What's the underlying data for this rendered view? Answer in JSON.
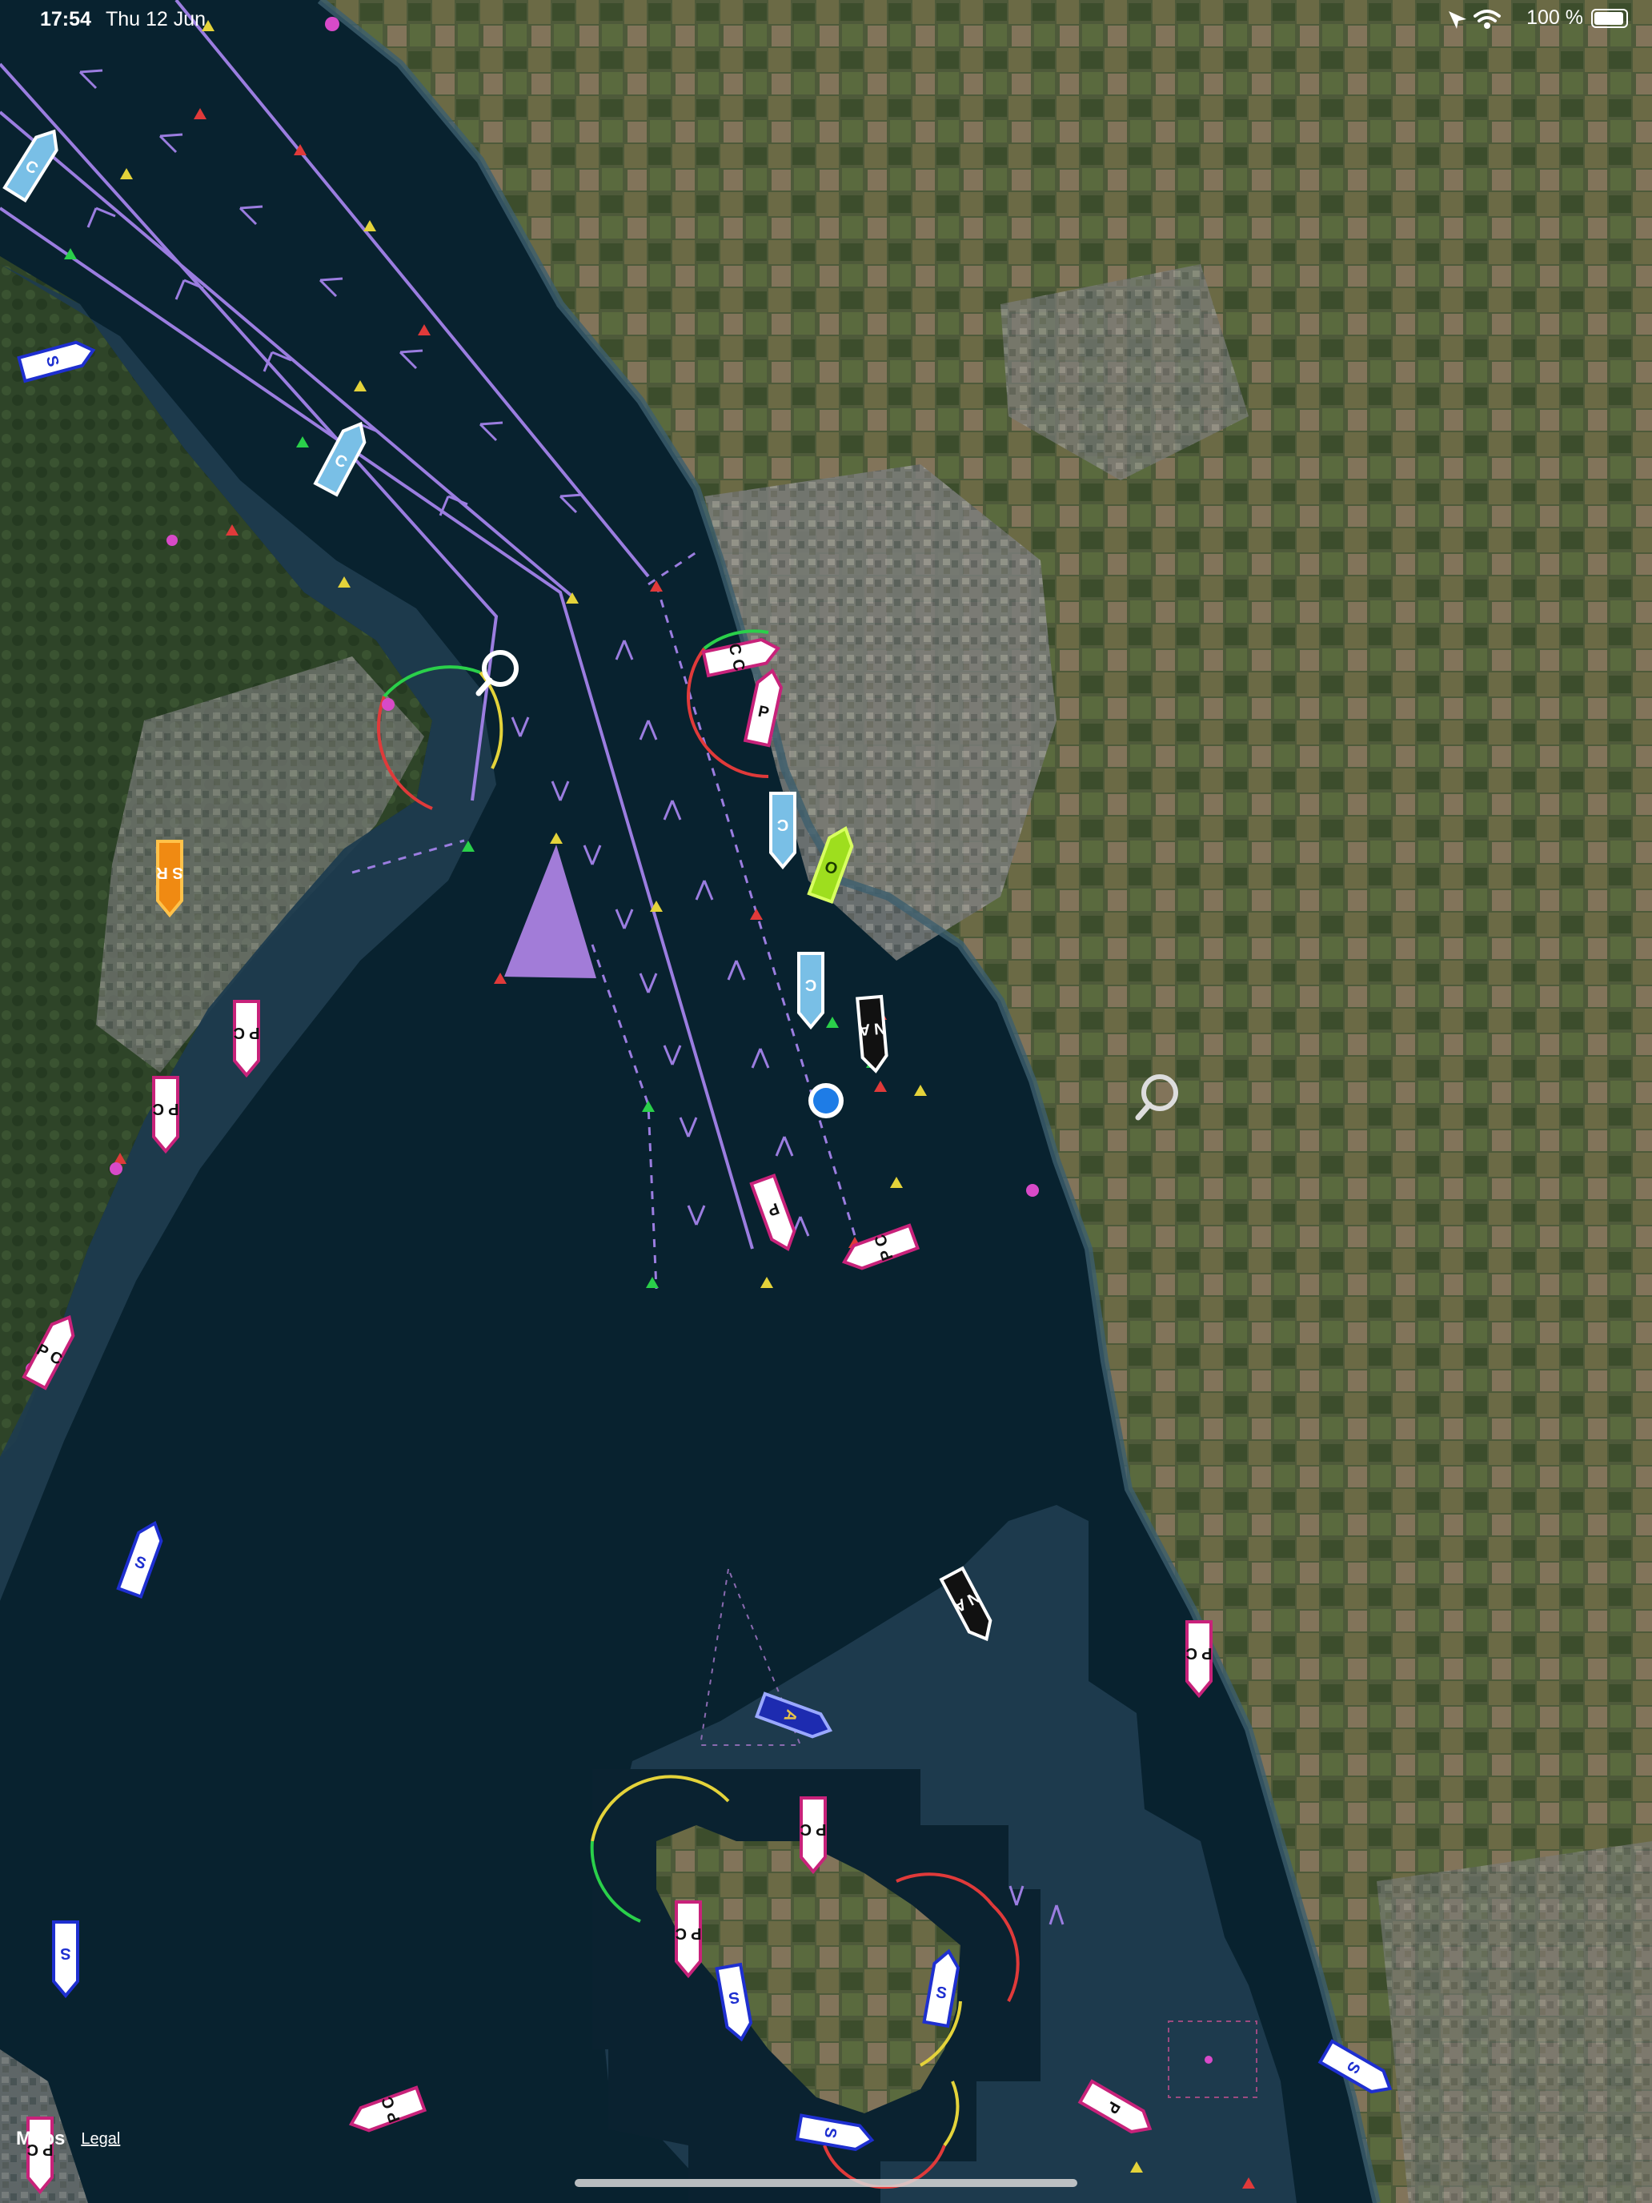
{
  "status_bar": {
    "time": "17:54",
    "date": "Thu 12 Jun",
    "battery": "100 %"
  },
  "map": {
    "vessels": [
      {
        "id": "v1",
        "label": "C",
        "icon": "vessel-light-blue"
      },
      {
        "id": "v2",
        "label": "S",
        "icon": "vessel-blue"
      },
      {
        "id": "v3",
        "label": "C",
        "icon": "vessel-light-blue"
      },
      {
        "id": "v4",
        "label": "S R",
        "icon": "vessel-orange"
      },
      {
        "id": "v5",
        "label": "P C",
        "icon": "vessel-white"
      },
      {
        "id": "v6",
        "label": "P C",
        "icon": "vessel-white"
      },
      {
        "id": "v7",
        "label": "P C",
        "icon": "vessel-white"
      },
      {
        "id": "v8",
        "label": "C C",
        "icon": "vessel-white"
      },
      {
        "id": "v9",
        "label": "P",
        "icon": "vessel-white"
      },
      {
        "id": "v10",
        "label": "C",
        "icon": "vessel-light-blue"
      },
      {
        "id": "v11",
        "label": "O",
        "icon": "vessel-lime"
      },
      {
        "id": "v12",
        "label": "C",
        "icon": "vessel-light-blue"
      },
      {
        "id": "v13",
        "label": "N A",
        "icon": "vessel-black"
      },
      {
        "id": "v14",
        "label": "P",
        "icon": "vessel-white"
      },
      {
        "id": "v15",
        "label": "P C",
        "icon": "vessel-white"
      },
      {
        "id": "v16",
        "label": "S",
        "icon": "vessel-blue"
      },
      {
        "id": "v17",
        "label": "N A",
        "icon": "vessel-black"
      },
      {
        "id": "v18",
        "label": "A",
        "icon": "vessel-navy"
      },
      {
        "id": "v19",
        "label": "P C",
        "icon": "vessel-white"
      },
      {
        "id": "v20",
        "label": "P C",
        "icon": "vessel-white"
      },
      {
        "id": "v21",
        "label": "P C",
        "icon": "vessel-white"
      },
      {
        "id": "v22",
        "label": "S",
        "icon": "vessel-blue"
      },
      {
        "id": "v23",
        "label": "S",
        "icon": "vessel-blue"
      },
      {
        "id": "v24",
        "label": "S",
        "icon": "vessel-blue"
      },
      {
        "id": "v25",
        "label": "P C",
        "icon": "vessel-white"
      },
      {
        "id": "v26",
        "label": "S",
        "icon": "vessel-blue"
      },
      {
        "id": "v27",
        "label": "P",
        "icon": "vessel-white"
      },
      {
        "id": "v28",
        "label": "S",
        "icon": "vessel-blue"
      },
      {
        "id": "v29",
        "label": "P C",
        "icon": "vessel-white"
      }
    ],
    "colors": {
      "deep_water": "#08222f",
      "shallow_water": "#1d3a4d",
      "lane": "#9b7de0",
      "own_position": "#1e7ce6"
    }
  },
  "attribution": {
    "brand": "Maps",
    "legal": "Legal"
  }
}
